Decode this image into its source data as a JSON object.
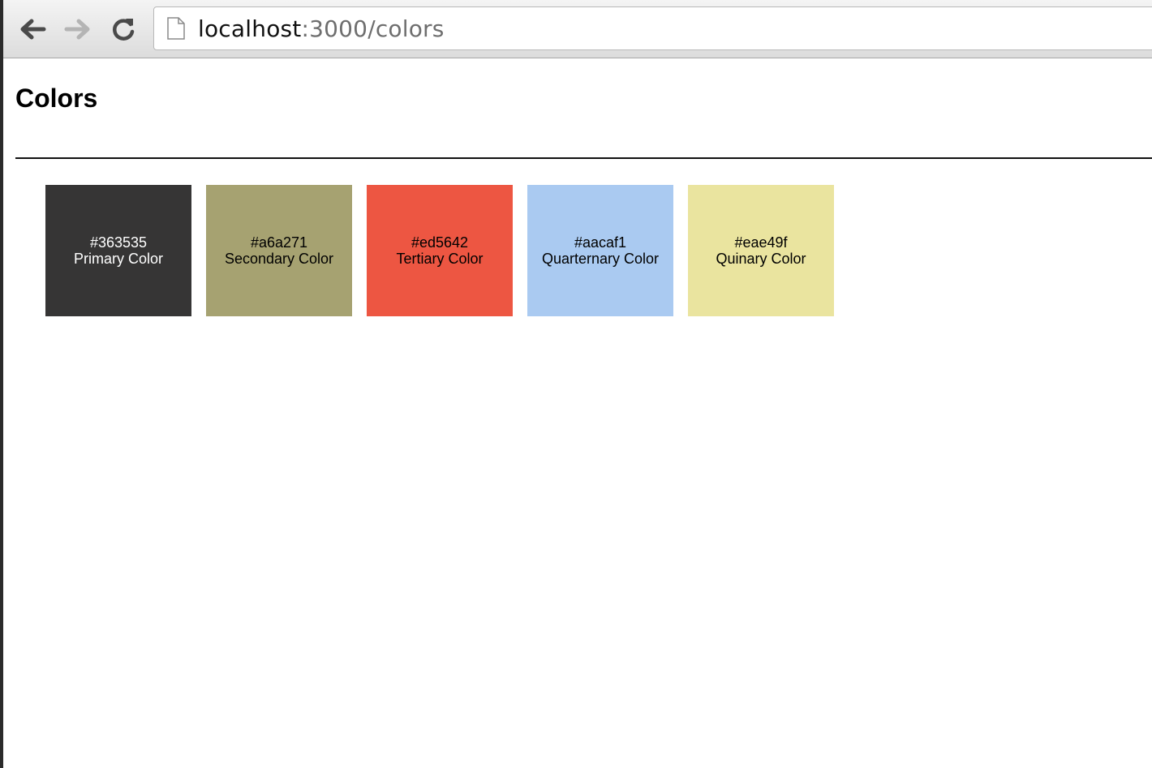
{
  "browser": {
    "url_host": "localhost",
    "url_rest": ":3000/colors"
  },
  "page": {
    "title": "Colors"
  },
  "swatches": [
    {
      "hex": "#363535",
      "label": "Primary Color",
      "text_color": "#ffffff"
    },
    {
      "hex": "#a6a271",
      "label": "Secondary Color",
      "text_color": "#000000"
    },
    {
      "hex": "#ed5642",
      "label": "Tertiary Color",
      "text_color": "#000000"
    },
    {
      "hex": "#aacaf1",
      "label": "Quarternary Color",
      "text_color": "#000000"
    },
    {
      "hex": "#eae49f",
      "label": "Quinary Color",
      "text_color": "#000000"
    }
  ]
}
